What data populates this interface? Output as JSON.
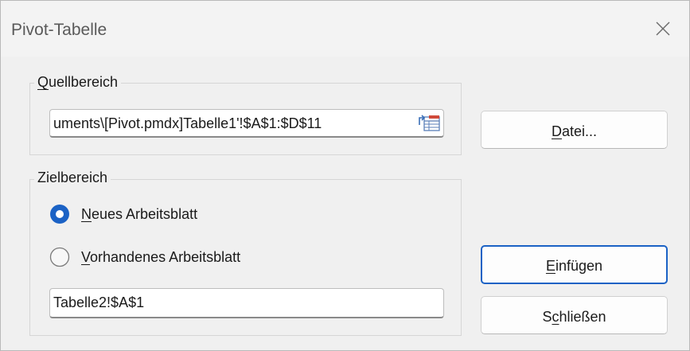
{
  "window": {
    "title": "Pivot-Tabelle"
  },
  "source_group": {
    "legend_underlined": "Q",
    "legend_rest": "uellbereich",
    "range_value": "uments\\[Pivot.pmdx]Tabelle1'!$A$1:$D$11"
  },
  "target_group": {
    "legend": "Zielbereich",
    "options": [
      {
        "underlined": "N",
        "rest": "eues Arbeitsblatt",
        "selected": true
      },
      {
        "underlined": "V",
        "rest": "orhandenes Arbeitsblatt",
        "selected": false
      }
    ],
    "target_value": "Tabelle2!$A$1"
  },
  "buttons": {
    "file": {
      "underlined": "D",
      "rest": "atei..."
    },
    "insert": {
      "underlined": "E",
      "rest": "infügen"
    },
    "close": {
      "before": "S",
      "underlined": "c",
      "rest": "hließen"
    }
  },
  "colors": {
    "accent": "#1b62c5",
    "dialog_bg": "#f0f0f0"
  },
  "icons": {
    "close": "close-icon",
    "range_picker": "range-select-icon"
  }
}
